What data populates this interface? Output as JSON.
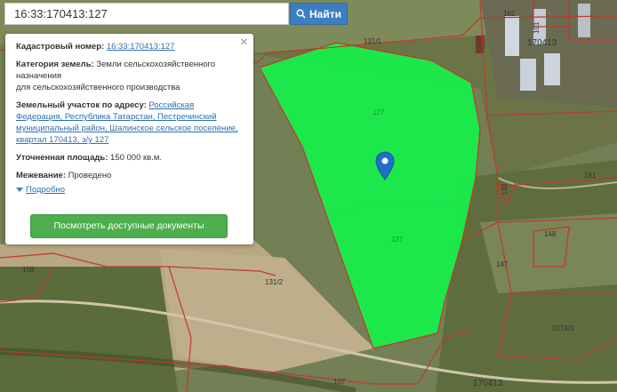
{
  "search": {
    "value": "16:33:170413:127",
    "button_label": "Найти"
  },
  "panel": {
    "cadastral_label": "Кадастровый номер:",
    "cadastral_value": "16:33:170413:127",
    "category_label": "Категория земель:",
    "category_value_1": "Земли сельскохозяйственного",
    "category_value_2": "назначения",
    "category_value_3": "для сельскохозяйственного производства",
    "address_label": "Земельный участок по адресу:",
    "address_1": "Российская",
    "address_2": "Федерация, Республика Татарстан, Пестречинский",
    "address_3": "муниципальный район, Шалинское сельское поселение,",
    "address_4": "квартал 170413, з/у 127",
    "area_label": "Уточненная площадь:",
    "area_value": "150 000 кв.м.",
    "survey_label": "Межевание:",
    "survey_value": "Проведено",
    "more_label": "Подробно",
    "docs_button": "Посмотреть доступные документы"
  },
  "map_labels": {
    "l161a": "161",
    "l101": "101",
    "l170413a": "170413",
    "l1311": "131/1",
    "l127a": "127",
    "l127b": "127",
    "l130": "130",
    "l161b": "161",
    "l148": "148",
    "l147": "147",
    "l158": "158",
    "l1312": "131/2",
    "l20743": "2074/3",
    "l107": "107",
    "l170413b": "170413"
  },
  "colors": {
    "parcel_fill": "#14f44a",
    "boundary": "#c0392b",
    "accent": "#3c7fc1",
    "docs_button": "#4cae4c"
  }
}
